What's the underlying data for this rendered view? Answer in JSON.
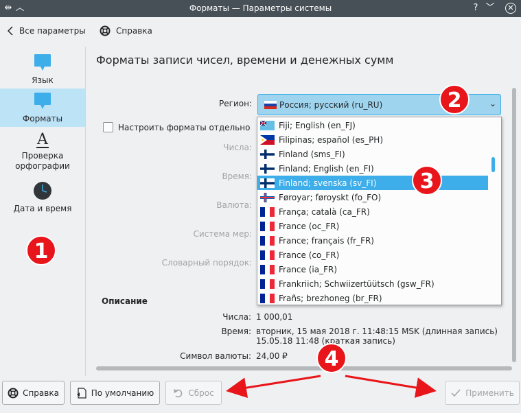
{
  "window": {
    "title": "Форматы — Параметры системы"
  },
  "toolbar": {
    "back_label": "Все параметры",
    "help_label": "Справка"
  },
  "sidebar": {
    "items": [
      {
        "label": "Язык"
      },
      {
        "label": "Форматы"
      },
      {
        "label": "Проверка орфографии"
      },
      {
        "label": "Дата и время"
      }
    ]
  },
  "main": {
    "title": "Форматы записи чисел, времени и денежных сумм",
    "region_label": "Регион:",
    "region_value": "Россия; русский (ru_RU)",
    "checkbox_label": "Настроить форматы отдельно",
    "fields": [
      {
        "label": "Числа:"
      },
      {
        "label": "Время:"
      },
      {
        "label": "Валюта:"
      },
      {
        "label": "Система мер:"
      },
      {
        "label": "Словарный порядок:"
      }
    ],
    "description": {
      "title": "Описание",
      "numbers_label": "Числа:",
      "numbers_value": "1 000,01",
      "time_label": "Время:",
      "time_value_long": "вторник, 15 мая 2018 г. 11:48:15 MSK (длинная запись)",
      "time_value_short": "15.05.18 11:48 (краткая запись)",
      "currency_label": "Символ валюты:",
      "currency_value": "24,00 ₽"
    }
  },
  "dropdown": {
    "items": [
      {
        "label": "Fiji; English (en_FJ)",
        "flag": "fiji"
      },
      {
        "label": "Filipinas; español (es_PH)",
        "flag": "philippines"
      },
      {
        "label": "Finland (sms_FI)",
        "flag": "finland"
      },
      {
        "label": "Finland; English (en_FI)",
        "flag": "finland"
      },
      {
        "label": "Finland; svenska (sv_FI)",
        "flag": "finland",
        "selected": true
      },
      {
        "label": "Føroyar; føroyskt (fo_FO)",
        "flag": "faroe"
      },
      {
        "label": "França; català (ca_FR)",
        "flag": "france"
      },
      {
        "label": "France (oc_FR)",
        "flag": "france"
      },
      {
        "label": "France; français (fr_FR)",
        "flag": "france"
      },
      {
        "label": "France (co_FR)",
        "flag": "france"
      },
      {
        "label": "France (ia_FR)",
        "flag": "france"
      },
      {
        "label": "Frankriich; Schwiizertüütsch (gsw_FR)",
        "flag": "france"
      },
      {
        "label": "Frañs; brezhoneg (br_FR)",
        "flag": "france"
      }
    ]
  },
  "buttons": {
    "help": "Справка",
    "defaults": "По умолчанию",
    "reset": "Сброс",
    "apply": "Применить"
  },
  "annotations": {
    "one": "1",
    "two": "2",
    "three": "3",
    "four": "4"
  },
  "colors": {
    "accent": "#3daee9",
    "selection": "#bde3f7",
    "annotation": "#e8151b",
    "titlebar": "#475057"
  }
}
